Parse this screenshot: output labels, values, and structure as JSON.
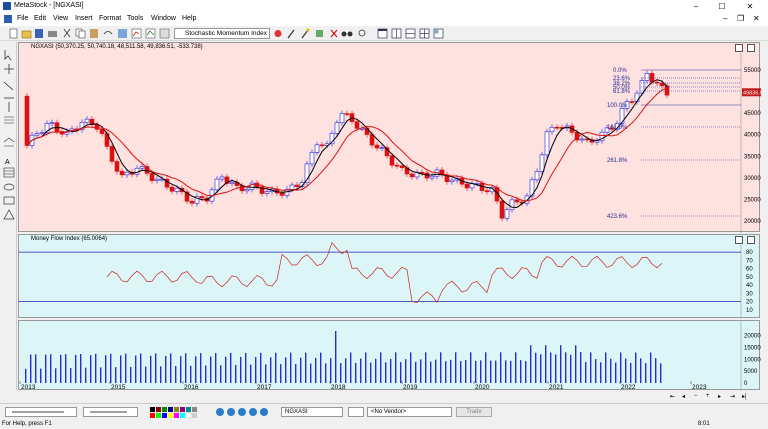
{
  "app": {
    "title": "MetaStock - [NGXASI]",
    "menus": [
      "File",
      "Edit",
      "View",
      "Insert",
      "Format",
      "Tools",
      "Window",
      "Help"
    ],
    "indicator_label": "Stochastic Momentum Index",
    "window_buttons": [
      "–",
      "☐",
      "✕"
    ],
    "child_close": "✕"
  },
  "panes": {
    "price_header": "NGXASI (50,370.25, 50,740.18, 48,511.58, 49,836.51, -533.738)",
    "mfi_header": "Money Flow Index (65.0064)",
    "last_price_tag": "49836.51",
    "price_ticks": [
      "55000",
      "50000",
      "45000",
      "40000",
      "35000",
      "30000",
      "25000",
      "20000"
    ],
    "mfi_ticks": [
      "80",
      "70",
      "60",
      "50",
      "40",
      "30",
      "20",
      "10"
    ],
    "vol_ticks": [
      "20000",
      "15000",
      "10000",
      "5000",
      "0"
    ],
    "fib_labels": [
      "0.0%",
      "23.6%",
      "38.2%",
      "50.0%",
      "61.8%",
      "100.0%",
      "161.8%",
      "261.8%",
      "423.6%"
    ],
    "years": [
      "2013",
      "2015",
      "2016",
      "2017",
      "2018",
      "2019",
      "2020",
      "2021",
      "2022",
      "2023"
    ]
  },
  "bottom": {
    "symbol": "NGXASI",
    "vendor": "<No Vendor>",
    "trade_button": "Trade"
  },
  "status": {
    "help": "For Help, press F1",
    "time": "8:01"
  },
  "colors": {
    "price_bg": "#fde2e0",
    "indicator_bg": "#dcf6f8",
    "candle_up": "#2222dd",
    "candle_down": "#dd1111",
    "ma_fast": "#000000",
    "ma_slow": "#dd1111",
    "mfi_line": "#cc2222",
    "band_line": "#2222aa"
  }
}
